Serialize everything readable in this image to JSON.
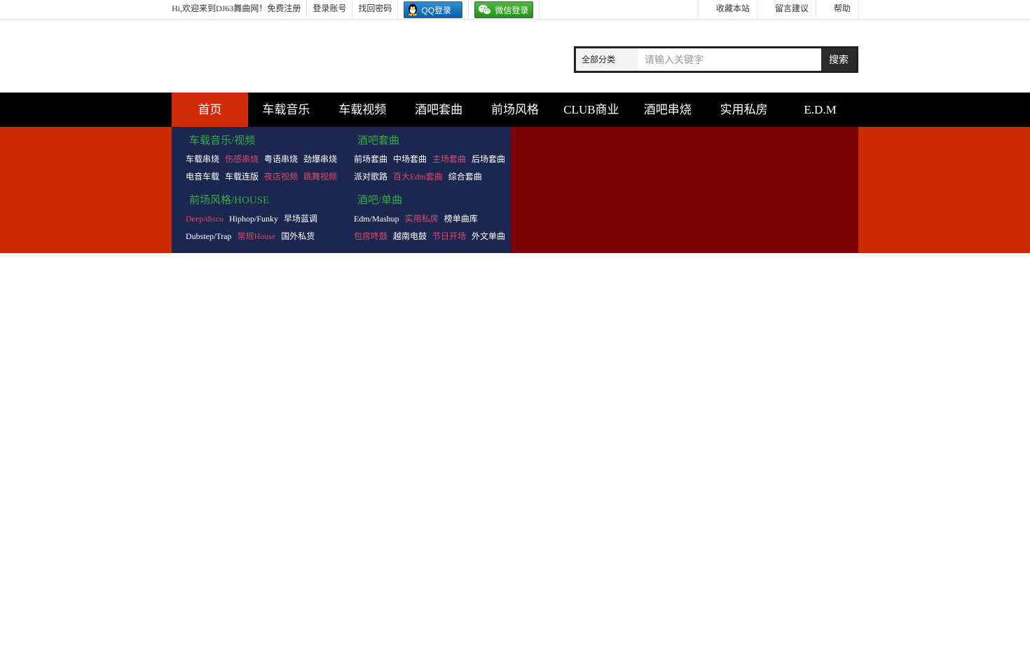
{
  "topbar": {
    "welcome": "Hi,欢迎来到DJ63舞曲网！免费注册",
    "login": "登录账号",
    "recover": "找回密码",
    "qq_login": "QQ登录",
    "wechat_login": "微信登录",
    "right_links": [
      "收藏本站",
      "留言建议",
      "帮助"
    ]
  },
  "search": {
    "category": "全部分类",
    "placeholder": "请输入关键字",
    "button": "搜索"
  },
  "nav": {
    "items": [
      "首页",
      "车载音乐",
      "车载视频",
      "酒吧套曲",
      "前场风格",
      "CLUB商业",
      "酒吧串烧",
      "实用私房",
      "E.D.M"
    ]
  },
  "menu": {
    "groups": [
      {
        "title": "车载音乐/视频",
        "rows": [
          [
            {
              "t": "车载串烧",
              "hot": false
            },
            {
              "t": "伤感串烧",
              "hot": true
            },
            {
              "t": "粤语串烧",
              "hot": false
            },
            {
              "t": "劲爆串烧",
              "hot": false
            }
          ],
          [
            {
              "t": "电音车载",
              "hot": false
            },
            {
              "t": "车载连版",
              "hot": false
            },
            {
              "t": "夜店视频",
              "hot": true
            },
            {
              "t": "跳舞视频",
              "hot": true
            }
          ]
        ]
      },
      {
        "title": "酒吧套曲",
        "rows": [
          [
            {
              "t": "前场套曲",
              "hot": false
            },
            {
              "t": "中场套曲",
              "hot": false
            },
            {
              "t": "主场套曲",
              "hot": true
            },
            {
              "t": "后场套曲",
              "hot": false
            }
          ],
          [
            {
              "t": "派对歌路",
              "hot": false
            },
            {
              "t": "百大Edm套曲",
              "hot": true
            },
            {
              "t": "综合套曲",
              "hot": false
            }
          ]
        ]
      },
      {
        "title": "前场风格/HOUSE",
        "rows": [
          [
            {
              "t": "Deep/disco",
              "hot": true
            },
            {
              "t": "Hiphop/Funky",
              "hot": false
            },
            {
              "t": "早场蓝调",
              "hot": false
            }
          ],
          [
            {
              "t": "Dubstep/Trap",
              "hot": false
            },
            {
              "t": "常规House",
              "hot": true
            },
            {
              "t": "国外私货",
              "hot": false
            }
          ]
        ]
      },
      {
        "title": "酒吧/单曲",
        "rows": [
          [
            {
              "t": "Edm/Mashup",
              "hot": false
            },
            {
              "t": "实用私房",
              "hot": true
            },
            {
              "t": "榜单曲库",
              "hot": false
            }
          ],
          [
            {
              "t": "包房咚鼓",
              "hot": true
            },
            {
              "t": "越南电鼓",
              "hot": false
            },
            {
              "t": "节日开场",
              "hot": true
            },
            {
              "t": "外文单曲",
              "hot": false
            }
          ]
        ]
      }
    ]
  },
  "colors": {
    "nav_active": "#d12a06",
    "banner_red": "#cc2a03",
    "banner_dark": "#7c0001",
    "menu_bg": "#1b274f",
    "group_title": "#3aa94a",
    "hot_link": "#e0486c"
  }
}
